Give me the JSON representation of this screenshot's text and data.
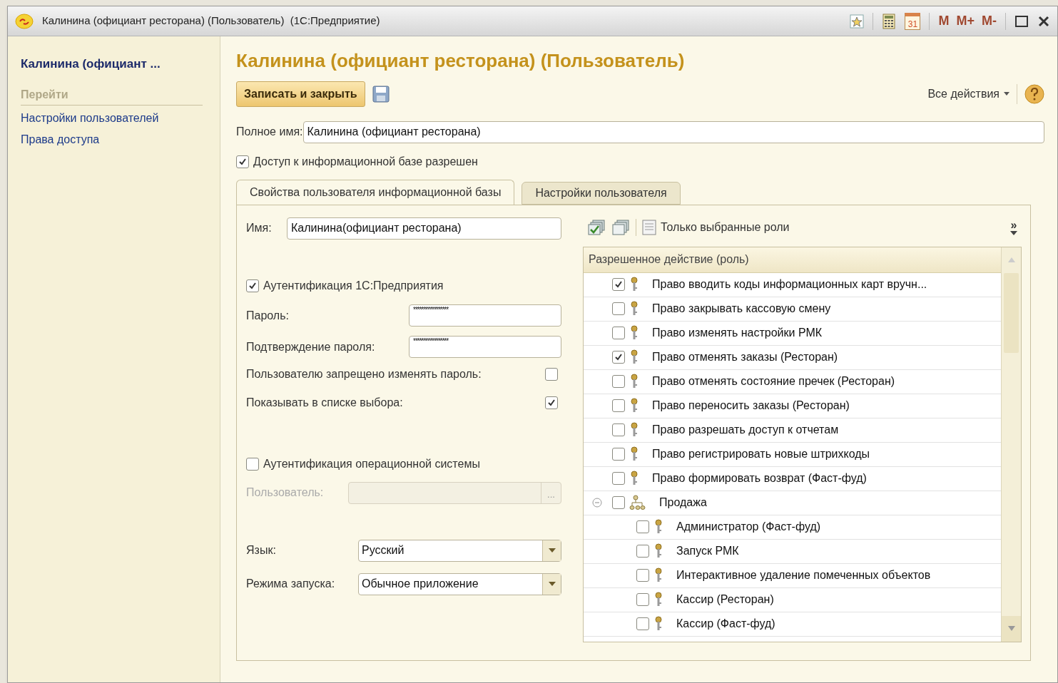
{
  "window": {
    "title": "Калинина (официант ресторана) (Пользователь)  (1С:Предприятие)",
    "calendar_day": "31",
    "memory_buttons": [
      "M",
      "M+",
      "M-"
    ]
  },
  "sidebar": {
    "header": "Калинина (официант ...",
    "section": "Перейти",
    "links": [
      "Настройки пользователей",
      "Права доступа"
    ]
  },
  "form": {
    "title": "Калинина (официант ресторана) (Пользователь)",
    "save_close": "Записать и закрыть",
    "all_actions": "Все действия",
    "full_name": {
      "label": "Полное имя:",
      "value": "Калинина (официант ресторана)"
    },
    "access": {
      "label": "Доступ к информационной базе разрешен",
      "checked": true
    }
  },
  "tabs": [
    {
      "label": "Свойства пользователя информационной базы",
      "selected": true
    },
    {
      "label": "Настройки пользователя",
      "selected": false
    }
  ],
  "properties": {
    "name": {
      "label": "Имя:",
      "value": "Калинина(официант ресторана)"
    },
    "auth_1c": {
      "label": "Аутентификация 1С:Предприятия",
      "checked": true
    },
    "password": {
      "label": "Пароль:",
      "value": "*****************"
    },
    "confirm": {
      "label": "Подтверждение пароля:",
      "value": "*****************"
    },
    "deny_change": {
      "label": "Пользователю запрещено изменять пароль:",
      "checked": false
    },
    "show_in_list": {
      "label": "Показывать в списке выбора:",
      "checked": true
    },
    "auth_os": {
      "label": "Аутентификация операционной системы",
      "checked": false
    },
    "os_user": {
      "label": "Пользователь:",
      "disabled": true,
      "button": "..."
    },
    "language": {
      "label": "Язык:",
      "value": "Русский"
    },
    "mode": {
      "label": "Режима запуска:",
      "value": "Обычное приложение"
    }
  },
  "roles": {
    "filter_label": "Только выбранные роли",
    "more": "»",
    "column": "Разрешенное действие (роль)",
    "items": [
      {
        "kind": "role",
        "label": "Право вводить коды информационных карт вручн...",
        "checked": true
      },
      {
        "kind": "role",
        "label": "Право закрывать кассовую смену",
        "checked": false
      },
      {
        "kind": "role",
        "label": "Право изменять настройки РМК",
        "checked": false
      },
      {
        "kind": "role",
        "label": "Право отменять заказы (Ресторан)",
        "checked": true
      },
      {
        "kind": "role",
        "label": "Право отменять состояние пречек (Ресторан)",
        "checked": false
      },
      {
        "kind": "role",
        "label": "Право переносить заказы (Ресторан)",
        "checked": false
      },
      {
        "kind": "role",
        "label": "Право разрешать доступ к отчетам",
        "checked": false
      },
      {
        "kind": "role",
        "label": "Право регистрировать новые штрихкоды",
        "checked": false
      },
      {
        "kind": "role",
        "label": "Право формировать возврат (Фаст-фуд)",
        "checked": false
      },
      {
        "kind": "group",
        "label": "Продажа",
        "checked": false,
        "expanded": true,
        "children": [
          {
            "kind": "role",
            "label": "Администратор (Фаст-фуд)",
            "checked": false
          },
          {
            "kind": "role",
            "label": "Запуск РМК",
            "checked": false
          },
          {
            "kind": "role",
            "label": "Интерактивное удаление помеченных объектов",
            "checked": false
          },
          {
            "kind": "role",
            "label": "Кассир (Ресторан)",
            "checked": false
          },
          {
            "kind": "role",
            "label": "Кассир (Фаст-фуд)",
            "checked": false
          }
        ]
      }
    ]
  }
}
